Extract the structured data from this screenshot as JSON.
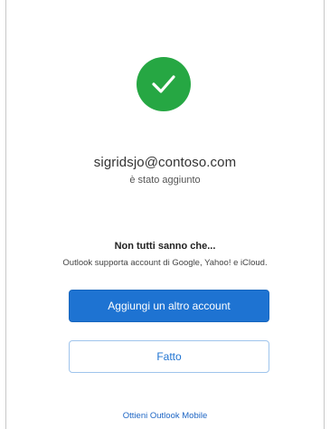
{
  "status": {
    "icon": "check-icon",
    "color": "#26a743"
  },
  "account": {
    "email": "sigridsjo@contoso.com",
    "added_text": "è stato aggiunto"
  },
  "tip": {
    "title": "Non tutti sanno che...",
    "text": "Outlook supporta account di Google, Yahoo! e iCloud."
  },
  "actions": {
    "add_account_label": "Aggiungi un altro account",
    "done_label": "Fatto",
    "mobile_link_label": "Ottieni Outlook Mobile"
  },
  "colors": {
    "accent": "#1e73d2"
  }
}
